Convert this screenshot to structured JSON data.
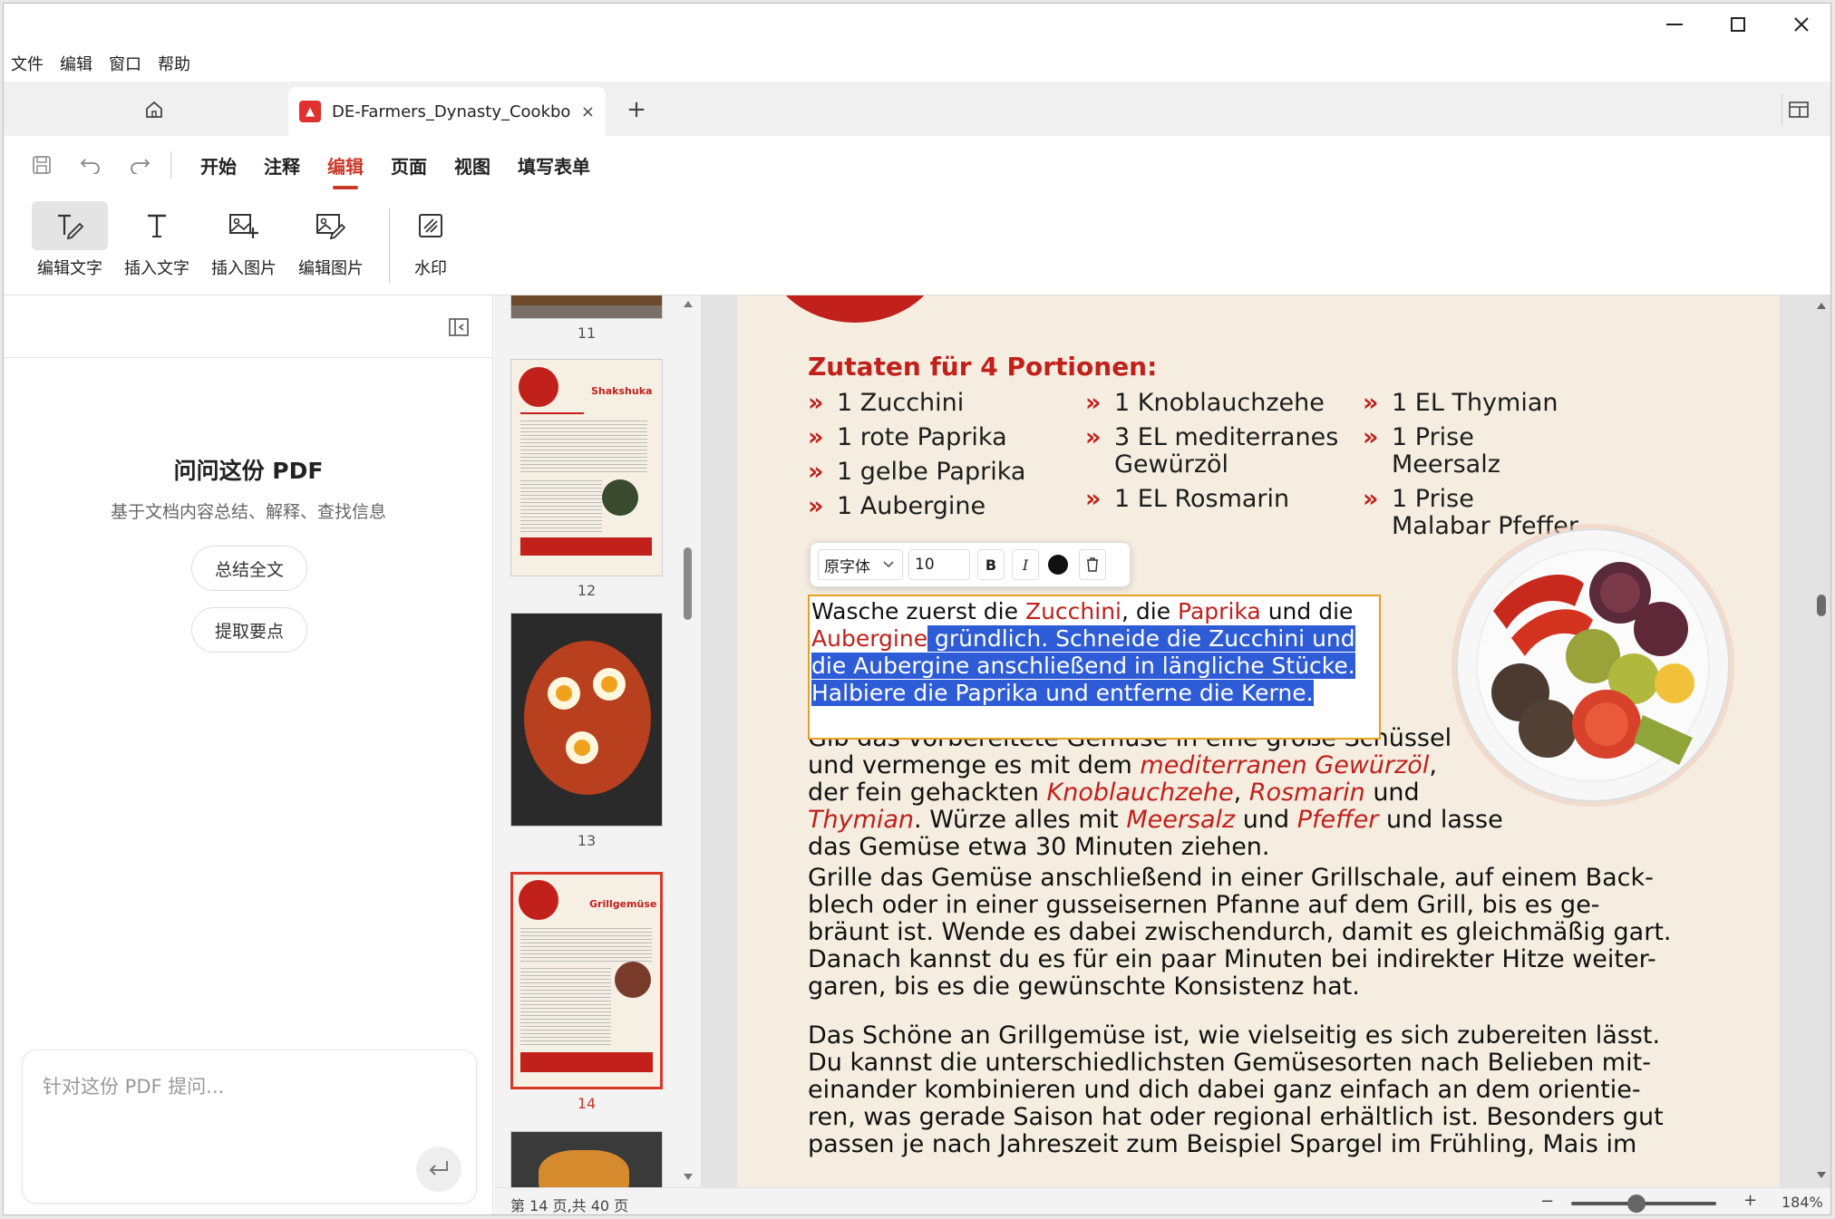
{
  "window": {
    "controls": {
      "minimize": "—",
      "maximize": "☐",
      "close": "✕"
    }
  },
  "menu": [
    "文件",
    "编辑",
    "窗口",
    "帮助"
  ],
  "tabs": {
    "doc_title": "DE-Farmers_Dynasty_Cookbo...",
    "pdf_badge": "▲",
    "close": "×",
    "add": "+"
  },
  "ribbon": {
    "tabs": [
      "开始",
      "注释",
      "编辑",
      "页面",
      "视图",
      "填写表单"
    ],
    "active_tab": "编辑",
    "tools": [
      {
        "label": "编辑文字",
        "icon": "edit-text-icon",
        "active": true
      },
      {
        "label": "插入文字",
        "icon": "insert-text-icon",
        "active": false
      },
      {
        "label": "插入图片",
        "icon": "insert-image-icon",
        "active": false
      },
      {
        "label": "编辑图片",
        "icon": "edit-image-icon",
        "active": false
      },
      {
        "label": "水印",
        "icon": "watermark-icon",
        "active": false
      }
    ]
  },
  "ai_panel": {
    "title": "问问这份 PDF",
    "subtitle": "基于文档内容总结、解释、查找信息",
    "buttons": [
      "总结全文",
      "提取要点"
    ],
    "input_placeholder": "针对这份 PDF 提问..."
  },
  "thumbnails": [
    {
      "page": "11",
      "selected": false
    },
    {
      "page": "12",
      "selected": false,
      "title": "Shakshuka"
    },
    {
      "page": "13",
      "selected": false
    },
    {
      "page": "14",
      "selected": true,
      "title": "Grillgemüse"
    }
  ],
  "document": {
    "ingredients_title": "Zutaten für 4 Portionen:",
    "ingredients": {
      "col1": [
        "1 Zucchini",
        "1 rote Paprika",
        "1 gelbe Paprika",
        "1 Aubergine"
      ],
      "col2": [
        "1 Knoblauchzehe",
        "3 EL mediterranes Gewürzöl",
        "1 EL Rosmarin"
      ],
      "col3": [
        "1 EL Thymian",
        "1 Prise Meersalz",
        "1 Prise Malabar Pfeffer"
      ]
    },
    "bullet": "»",
    "edit_box": {
      "p1_a": "Wasche zuerst die ",
      "p1_zucchini": "Zucchini",
      "p1_b": ", die ",
      "p1_paprika": "Paprika",
      "p1_c": " und die",
      "p1_aubergine": "Aubergine",
      "p1_selected": " gründlich. Schneide die Zucchini und die Aubergine anschließend in längliche Stücke. Halbiere die Paprika und entferne die Kerne."
    },
    "format_bar": {
      "font": "原字体",
      "size": "10",
      "bold": "B",
      "italic": "I"
    },
    "para2": {
      "line1": "Gib das vorbereitete Gemüse in eine große Schüssel",
      "a": "und vermenge es mit dem ",
      "oil": "mediterranen Gewürzöl",
      "b": ",",
      "c": "der fein gehackten ",
      "garlic": "Knoblauchzehe",
      "d": ", ",
      "rosemary": "Rosmarin",
      "e": " und",
      "thyme": "Thymian",
      "f": ". Würze alles mit ",
      "salt": "Meersalz",
      "g": " und ",
      "pepper": "Pfeffer",
      "h": " und lasse",
      "i": "das Gemüse etwa 30 Minuten ziehen."
    },
    "para3": [
      "Grille das Gemüse anschließend in einer Grillschale, auf einem Back-",
      "blech oder in einer gusseisernen Pfanne auf dem Grill, bis es ge-",
      "bräunt ist. Wende es dabei zwischendurch, damit es gleichmäßig gart.",
      "Danach kannst du es für ein paar Minuten bei indirekter Hitze weiter-",
      "garen, bis es die gewünschte Konsistenz hat."
    ],
    "para4": [
      "Das Schöne an Grillgemüse ist, wie vielseitig es sich zubereiten lässt.",
      "Du kannst die unterschiedlichsten Gemüsesorten nach Belieben mit-",
      "einander kombinieren und dich dabei ganz einfach an dem orientie-",
      "ren, was gerade Saison hat oder regional erhältlich ist. Besonders gut",
      "passen je nach Jahreszeit zum Beispiel Spargel im Frühling, Mais im"
    ]
  },
  "status": {
    "page_info": "第 14 页,共 40 页",
    "zoom": "184%",
    "zoom_minus": "−",
    "zoom_plus": "+"
  },
  "colors": {
    "accent": "#c93a2b",
    "recipe_red": "#c1201b",
    "selection": "#2e5bd6",
    "edit_border": "#e5a021"
  }
}
